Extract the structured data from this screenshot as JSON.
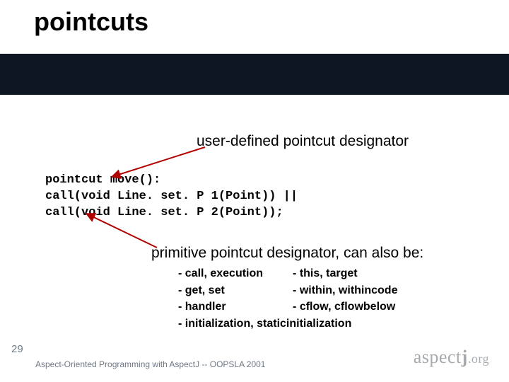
{
  "title": "pointcuts",
  "label_user": "user-defined pointcut designator",
  "code": {
    "line1_kw": "pointcut",
    "line1_rest": " move():",
    "line2a": "  call(",
    "line2_kw": "void",
    "line2b": " Line. set. P 1(Point)) ||",
    "line3a": "  call(",
    "line3_kw": "void",
    "line3b": " Line. set. P 2(Point));"
  },
  "label_prim": "primitive pointcut designator, can also be:",
  "bullets": {
    "c1r1": "- call, execution",
    "c1r2": "- get, set",
    "c1r3": "- handler",
    "c1r4": "- initialization, staticinitialization",
    "c2r1": "- this, target",
    "c2r2": "- within, withincode",
    "c2r3": "- cflow, cflowbelow"
  },
  "page_num": "29",
  "footer": "Aspect-Oriented Programming with AspectJ -- OOPSLA 2001",
  "logo": {
    "a": "aspect",
    "j": "j",
    "org": ".org"
  }
}
